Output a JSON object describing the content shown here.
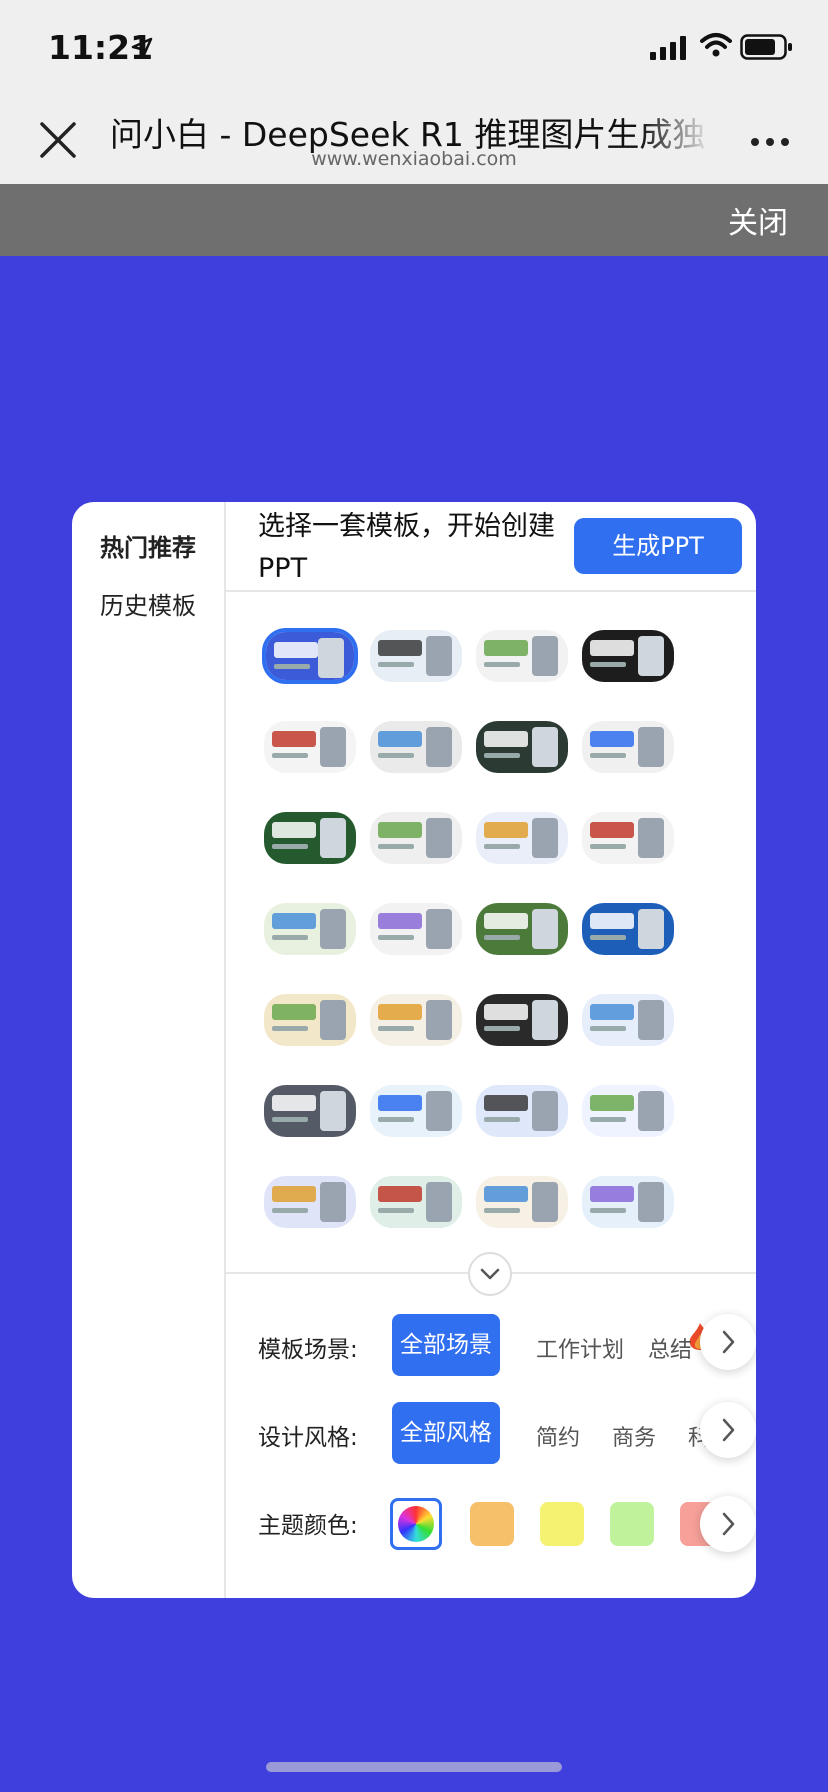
{
  "status": {
    "time": "11:21"
  },
  "nav": {
    "title": "问小白 - DeepSeek R1 推理图片生成独",
    "url": "www.wenxiaobai.com"
  },
  "overlay": {
    "close_label": "关闭"
  },
  "sidebar": {
    "items": [
      {
        "label": "热门推荐"
      },
      {
        "label": "历史模板"
      }
    ]
  },
  "main": {
    "title": "选择一套模板，开始创建PPT",
    "generate_label": "生成PPT",
    "template_count": 28,
    "selected_template_index": 0,
    "thumb_palettes": [
      "#3b5bd8",
      "#e8eef5",
      "#f2f2f2",
      "#1d1d1d",
      "#f4f4f4",
      "#eaeaea",
      "#2b3b34",
      "#f0f0f0",
      "#245a2e",
      "#efefef",
      "#e9eef8",
      "#f3f3f3",
      "#e8f0e0",
      "#f2f2f2",
      "#4c7a3a",
      "#1d5fb8",
      "#f3e7c9",
      "#f5f0e6",
      "#2a2a2a",
      "#e6eefb",
      "#555b66",
      "#e8f2fb",
      "#dfe8fb",
      "#eef3ff",
      "#dfe4f8",
      "#dfeee6",
      "#f6f1e4",
      "#e5f0fb"
    ]
  },
  "filters": {
    "scene": {
      "label": "模板场景:",
      "selected": "全部场景",
      "options": [
        "工作计划",
        "总结"
      ]
    },
    "style": {
      "label": "设计风格:",
      "selected": "全部风格",
      "options": [
        "简约",
        "商务",
        "科"
      ]
    },
    "color": {
      "label": "主题颜色:",
      "swatches": [
        "#f6c06a",
        "#f4f270",
        "#bff29a",
        "#f7a09a"
      ]
    }
  }
}
